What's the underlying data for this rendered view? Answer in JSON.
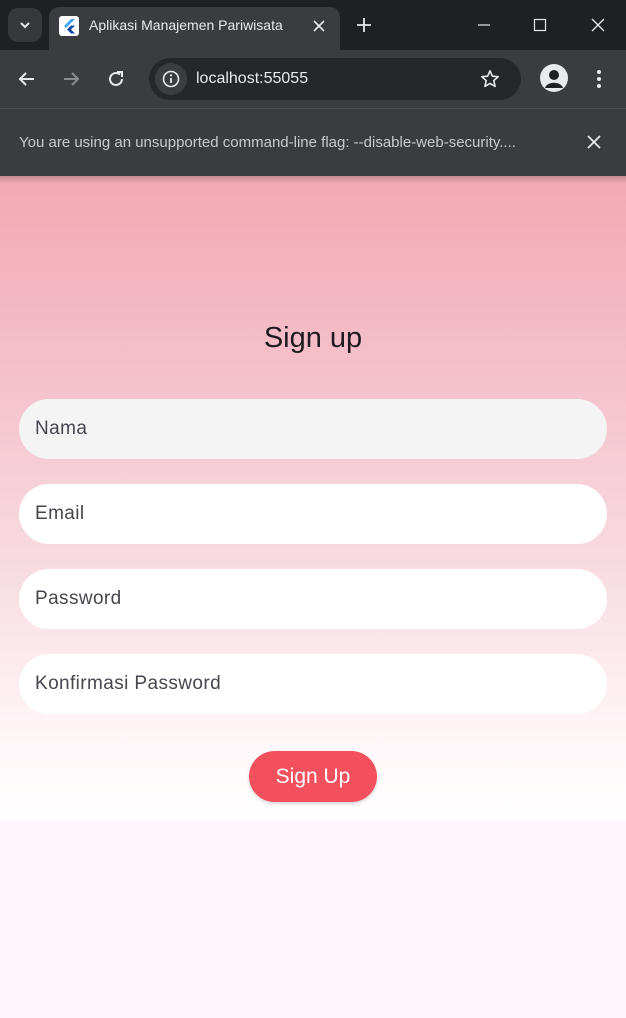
{
  "browser": {
    "tab_title": "Aplikasi Manajemen Pariwisata",
    "url": "localhost:55055",
    "infobar_message": "You are using an unsupported command-line flag: --disable-web-security...."
  },
  "page": {
    "heading": "Sign up",
    "fields": [
      {
        "placeholder": "Nama"
      },
      {
        "placeholder": "Email"
      },
      {
        "placeholder": "Password"
      },
      {
        "placeholder": "Konfirmasi Password"
      }
    ],
    "submit_label": "Sign Up"
  },
  "colors": {
    "accent": "#f2505d",
    "gradient_top": "#f2a9b3",
    "gradient_bottom": "#ffffff"
  },
  "icons": [
    "chevron-down-icon",
    "flutter-logo-icon",
    "close-icon",
    "plus-icon",
    "minimize-icon",
    "maximize-icon",
    "back-icon",
    "forward-icon",
    "reload-icon",
    "info-icon",
    "star-icon",
    "profile-icon",
    "more-vert-icon"
  ]
}
